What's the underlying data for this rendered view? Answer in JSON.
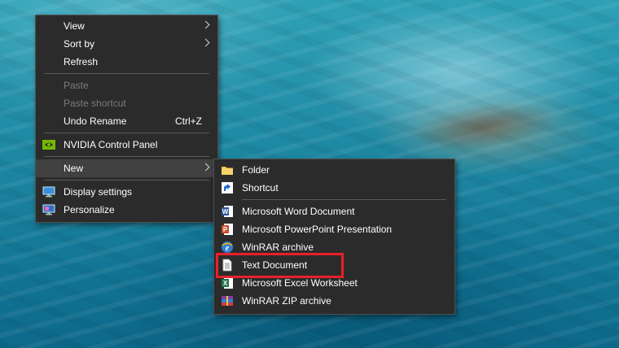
{
  "context_menu": {
    "items": [
      {
        "label": "View",
        "has_submenu": true
      },
      {
        "label": "Sort by",
        "has_submenu": true
      },
      {
        "label": "Refresh"
      },
      {
        "label": "Paste",
        "disabled": true
      },
      {
        "label": "Paste shortcut",
        "disabled": true
      },
      {
        "label": "Undo Rename",
        "shortcut": "Ctrl+Z"
      },
      {
        "label": "NVIDIA Control Panel",
        "icon": "nvidia-icon"
      },
      {
        "label": "New",
        "has_submenu": true,
        "hovered": true
      },
      {
        "label": "Display settings",
        "icon": "display-icon"
      },
      {
        "label": "Personalize",
        "icon": "personalize-icon"
      }
    ]
  },
  "new_submenu": {
    "items": [
      {
        "label": "Folder",
        "icon": "folder-icon"
      },
      {
        "label": "Shortcut",
        "icon": "shortcut-icon"
      },
      {
        "label": "Microsoft Word Document",
        "icon": "word-icon"
      },
      {
        "label": "Microsoft PowerPoint Presentation",
        "icon": "powerpoint-icon"
      },
      {
        "label": "WinRAR archive",
        "icon": "winrar-icon"
      },
      {
        "label": "Text Document",
        "icon": "text-document-icon",
        "highlighted": true
      },
      {
        "label": "Microsoft Excel Worksheet",
        "icon": "excel-icon"
      },
      {
        "label": "WinRAR ZIP archive",
        "icon": "winrar-zip-icon"
      }
    ]
  },
  "colors": {
    "menu_bg": "#2b2b2b",
    "hover_bg": "#414141",
    "highlight_border": "#e8202a",
    "disabled_text": "#7a7a7a"
  }
}
